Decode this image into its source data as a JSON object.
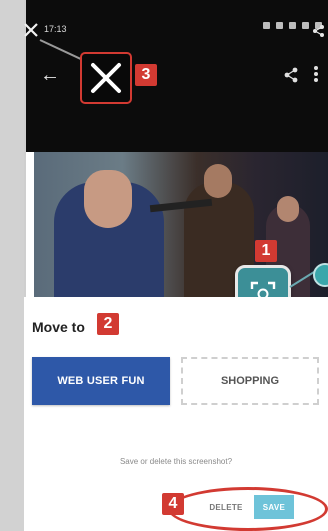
{
  "status_bar": {
    "time": "17:13"
  },
  "callouts": {
    "one": "1",
    "two": "2",
    "three": "3",
    "four": "4"
  },
  "sheet": {
    "title": "Move to",
    "chips": [
      "WEB USER FUN",
      "SHOPPING"
    ],
    "prompt": "Save or delete this screenshot?",
    "delete_label": "DELETE",
    "save_label": "SAVE"
  },
  "icons": {
    "back": "back-arrow-icon",
    "share": "share-icon",
    "more": "more-vert-icon",
    "close": "close-icon",
    "scan": "screenshot-scan-icon"
  },
  "colors": {
    "accent_red": "#d23a32",
    "primary_chip": "#2e58a8",
    "save_button": "#6ec3d9",
    "scan_button": "#3c8f97"
  }
}
